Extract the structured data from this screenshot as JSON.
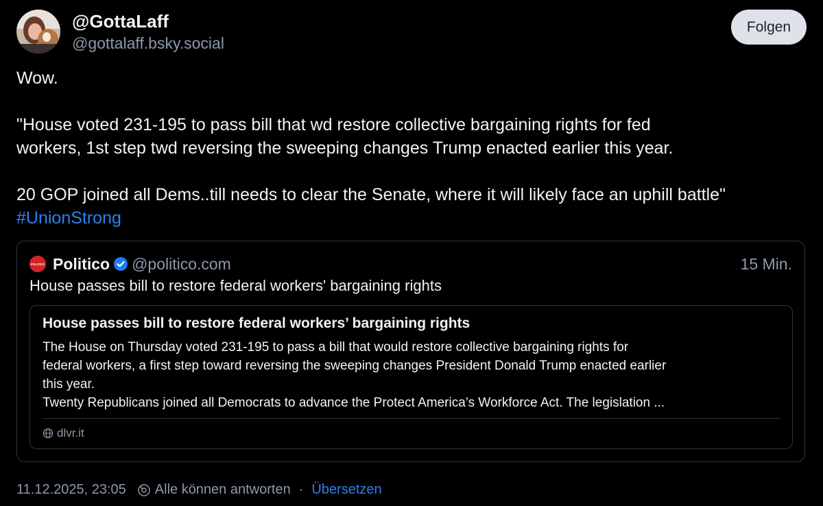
{
  "author": {
    "display_name": "@GottaLaff",
    "handle": "@gottalaff.bsky.social",
    "follow_label": "Folgen"
  },
  "post": {
    "lines": [
      "Wow.",
      "\"House voted 231-195 to pass  bill that wd restore collective bargaining rights for fed",
      "workers, 1st step twd reversing the sweeping changes Trump enacted earlier this year.",
      "20 GOP joined all Dems..till needs to clear the Senate, where it will likely face an uphill battle\""
    ],
    "hashtag": "#UnionStrong"
  },
  "quote": {
    "name": "Politico",
    "handle": "@politico.com",
    "time": "15 Min.",
    "text": "House passes bill to restore federal workers' bargaining rights",
    "logo_text": "POLITICO",
    "card": {
      "title": "House passes bill to restore federal workers’ bargaining rights",
      "description_lines": [
        "The House on Thursday voted 231-195 to pass a bill that would restore collective bargaining rights for",
        "federal workers, a first step toward reversing the sweeping changes President Donald Trump enacted earlier",
        "this year.",
        "Twenty Republicans joined all Democrats to advance the Protect America’s Workforce Act. The legislation ..."
      ],
      "domain": "dlvr.it"
    }
  },
  "footer": {
    "timestamp": "11.12.2025, 23:05",
    "reply_setting": "Alle können antworten",
    "separator": "·",
    "translate": "Übersetzen"
  },
  "colors": {
    "background": "#000000",
    "text": "#f1f3f5",
    "muted": "#8d99ab",
    "link": "#2f80ed",
    "border": "#2e3540",
    "politico_red": "#d1242a",
    "verified_blue": "#1d7cf2"
  }
}
